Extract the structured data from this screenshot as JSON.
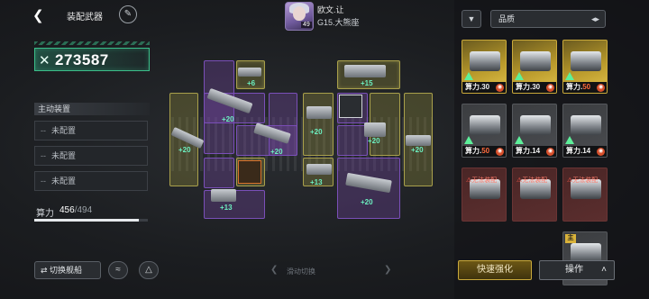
{
  "header": {
    "back_icon": "back-arrow-icon",
    "title": "装配武器",
    "edit_icon": "pencil-icon"
  },
  "commander": {
    "name": "欧文.让",
    "level": "49",
    "rank": "G15.大熊座"
  },
  "power": {
    "icon": "crossed-swords-icon",
    "value": "273587"
  },
  "active_equipment": {
    "title": "主动装置",
    "slots": [
      {
        "dash": "--",
        "label": "未配置"
      },
      {
        "dash": "--",
        "label": "未配置"
      },
      {
        "dash": "--",
        "label": "未配置"
      }
    ]
  },
  "capacity": {
    "label": "算力",
    "used": "456",
    "total": "/494",
    "ratio": 0.923
  },
  "bottom_left": {
    "switch_ship_label": "切换舰船",
    "switch_icon": "swap-arrows-icon",
    "icon_2": "fleet-formation-icon",
    "icon_3": "radar-icon"
  },
  "swipe_hint": "滑动切换",
  "grid_bonuses": {
    "b1": "+6",
    "b2": "+15",
    "b3": "+20",
    "b4": "+20",
    "b5": "+20",
    "b6": "+20",
    "b7": "+20",
    "b8": "+20",
    "b9": "+13",
    "b10": "+13",
    "b11": "+20"
  },
  "right_panel": {
    "filter_icon": "funnel-icon",
    "quality_label": "品质",
    "sort_icon": "sort-toggle-icon",
    "cards": [
      {
        "power_label": "算力.",
        "power": "30",
        "style": "gold"
      },
      {
        "power_label": "算力.",
        "power": "30",
        "style": "gold"
      },
      {
        "power_label": "算力.",
        "power": "50",
        "style": "gold"
      },
      {
        "power_label": "算力.",
        "power": "50",
        "style": "dark"
      },
      {
        "power_label": "算力.",
        "power": "14",
        "style": "dark"
      },
      {
        "power_label": "算力.",
        "power": "14",
        "style": "dark"
      },
      {
        "warn": "无法装配",
        "style": "red"
      },
      {
        "warn": "无法装配",
        "style": "red"
      },
      {
        "warn": "无法装配",
        "style": "red"
      },
      {
        "tag": "主",
        "style": "dark"
      }
    ],
    "quick_enhance": "快速强化",
    "operation": "操作"
  },
  "colors": {
    "accent_green": "#3bbf8a",
    "slot_yellow": "#a9a04b",
    "slot_purple": "#7a4fb8",
    "gold_card": "#c9a93a",
    "power_orange": "#ff6a3d"
  }
}
